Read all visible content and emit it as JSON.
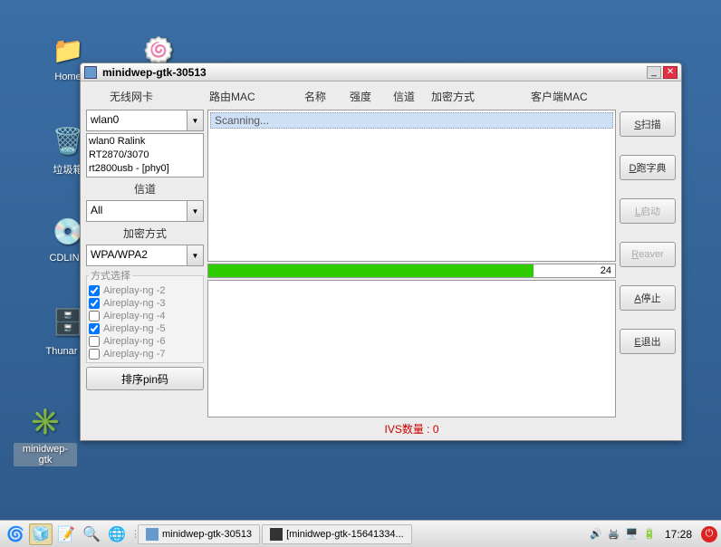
{
  "desktop": {
    "icons": {
      "home": "Home",
      "trash": "垃圾箱",
      "cdlinux": "CDLINU",
      "thunar": "Thunar 文",
      "minidwep": "minidwep-gtk"
    }
  },
  "window": {
    "title": "minidwep-gtk-30513",
    "headers": {
      "wlan": "无线网卡",
      "mac": "路由MAC",
      "name": "名称",
      "strength": "强度",
      "channel": "信道",
      "enc": "加密方式",
      "client": "客户端MAC"
    },
    "left": {
      "wlan_value": "wlan0",
      "wlan_list": [
        "wlan0 Ralink",
        "RT2870/3070",
        "rt2800usb - [phy0]"
      ],
      "channel_label": "信道",
      "channel_value": "All",
      "enc_label": "加密方式",
      "enc_value": "WPA/WPA2",
      "methods_title": "方式选择",
      "methods": [
        {
          "label": "Aireplay-ng -2",
          "checked": true
        },
        {
          "label": "Aireplay-ng -3",
          "checked": true
        },
        {
          "label": "Aireplay-ng -4",
          "checked": false
        },
        {
          "label": "Aireplay-ng -5",
          "checked": true
        },
        {
          "label": "Aireplay-ng -6",
          "checked": false
        },
        {
          "label": "Aireplay-ng -7",
          "checked": false
        }
      ],
      "sort_btn": "排序pin码"
    },
    "center": {
      "scanning": "Scanning...",
      "progress": "24",
      "ivs": "IVS数量 : 0"
    },
    "right": {
      "scan": "扫描",
      "scan_u": "S",
      "dict": "跑字典",
      "dict_u": "D",
      "launch": "启动",
      "launch_u": "L",
      "reaver": "eaver",
      "reaver_u": "R",
      "stop": "停止",
      "stop_u": "A",
      "exit": "退出",
      "exit_u": "E"
    }
  },
  "taskbar": {
    "task1": "minidwep-gtk-30513",
    "task2": "[minidwep-gtk-15641334...",
    "clock": "17:28"
  }
}
